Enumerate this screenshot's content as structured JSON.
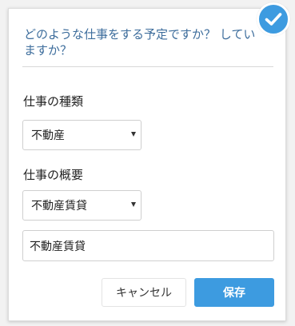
{
  "question": "どのような仕事をする予定ですか？ していますか？",
  "fields": {
    "job_type": {
      "label": "仕事の種類",
      "selected": "不動産"
    },
    "job_summary": {
      "label": "仕事の概要",
      "selected": "不動産賃貸",
      "input_value": "不動産賃貸"
    }
  },
  "buttons": {
    "cancel": "キャンセル",
    "save": "保存"
  },
  "icons": {
    "badge": "check-icon",
    "dropdown": "caret-down-icon"
  },
  "colors": {
    "accent": "#3d9be0",
    "question_text": "#3d6d9c"
  }
}
